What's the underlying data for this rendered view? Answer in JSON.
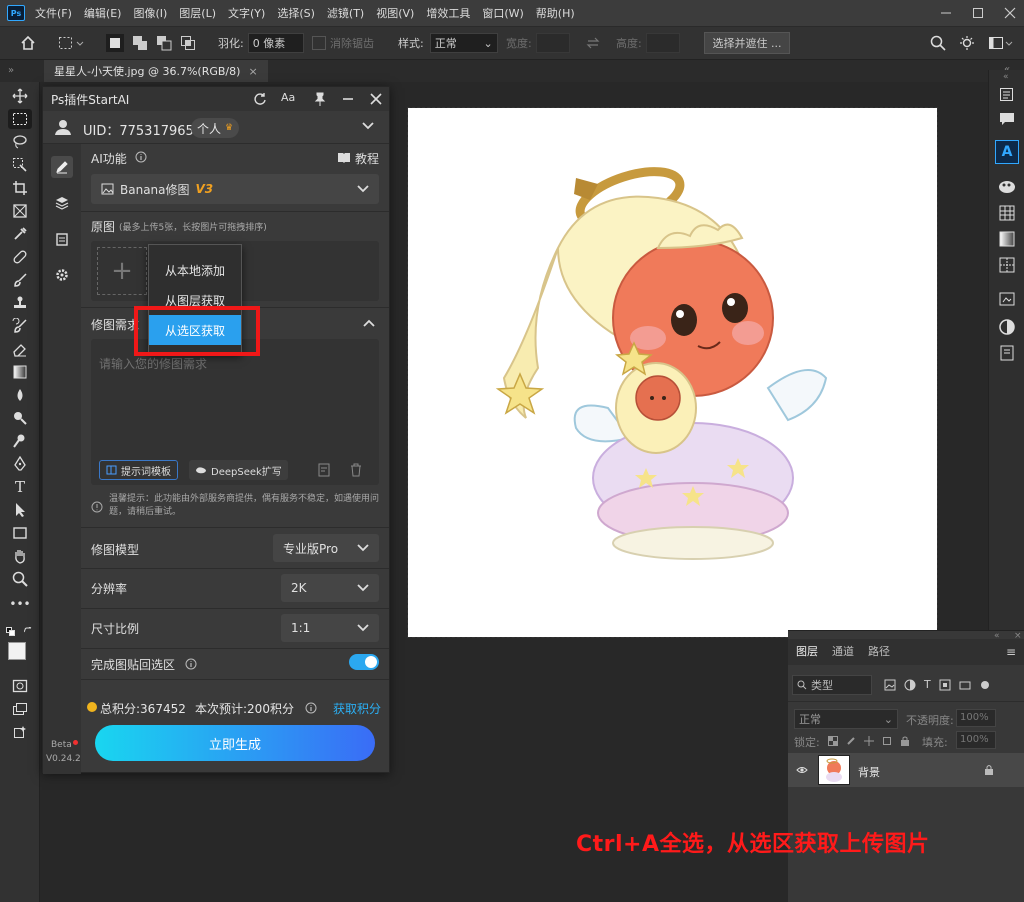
{
  "app": {
    "logo": "Ps"
  },
  "menu": [
    "文件(F)",
    "编辑(E)",
    "图像(I)",
    "图层(L)",
    "文字(Y)",
    "选择(S)",
    "滤镜(T)",
    "视图(V)",
    "增效工具",
    "窗口(W)",
    "帮助(H)"
  ],
  "options": {
    "feather_label": "羽化:",
    "feather_value": "0 像素",
    "antialias_label": "消除锯齿",
    "style_label": "样式:",
    "style_value": "正常",
    "width_label": "宽度:",
    "height_label": "高度:",
    "select_mask_button": "选择并遮住 ..."
  },
  "document_tab": {
    "title": "星星人-小天使.jpg @ 36.7%(RGB/8)",
    "close": "×"
  },
  "plugin": {
    "title": "Ps插件StartAI",
    "uid_label": "UID：775317965",
    "account_type": "个人",
    "ai_function_label": "AI功能",
    "tutorial_label": "教程",
    "model_select": "Banana修图",
    "model_version": "V3",
    "source_label": "原图",
    "source_hint": "(最多上传5张，长按图片可拖拽排序)",
    "edit_request_label": "修图需求",
    "prompt_placeholder": "请输入您的修图需求",
    "prompt_template_button": "提示词模板",
    "deepseek_button": "DeepSeek扩写",
    "notice": "温馨提示：此功能由外部服务商提供，偶有服务不稳定，如遇使用问题，请稍后重试。",
    "edit_model_label": "修图模型",
    "edit_model_value": "专业版Pro",
    "resolution_label": "分辨率",
    "resolution_value": "2K",
    "ratio_label": "尺寸比例",
    "ratio_value": "1:1",
    "paste_back_label": "完成图贴回选区",
    "paste_back_on": true,
    "points_label": "总积分:367452",
    "estimate_label": "本次预计:200积分",
    "get_points_link": "获取积分",
    "generate_button": "立即生成",
    "beta_label": "Beta",
    "version_label": "V0.24.2"
  },
  "popup_menu": {
    "items": [
      "从本地添加",
      "从图层获取",
      "从选区获取"
    ],
    "selected_index": 2
  },
  "layers_panel": {
    "tabs": [
      "图层",
      "通道",
      "路径"
    ],
    "active_tab": "图层",
    "filter_kind": "类型",
    "blend_mode": "正常",
    "opacity_label": "不透明度:",
    "opacity_value": "100%",
    "lock_label": "锁定:",
    "fill_label": "填充:",
    "fill_value": "100%",
    "layers": [
      {
        "name": "背景",
        "visible": true,
        "locked": true
      }
    ]
  },
  "caption": "Ctrl+A全选，从选区获取上传图片",
  "colors": {
    "accent_blue": "#31a8ff",
    "highlight_red": "#f01818",
    "caption_red": "#ff1a1a",
    "generate_start": "#19d6f0",
    "generate_end": "#3a6cf6",
    "version_orange": "#f0a020"
  }
}
